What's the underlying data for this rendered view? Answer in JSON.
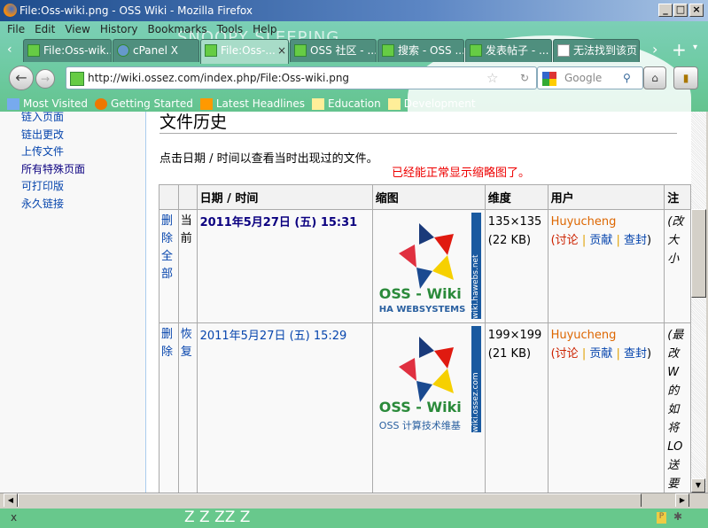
{
  "window": {
    "title": "File:Oss-wiki.png - OSS Wiki - Mozilla Firefox"
  },
  "menu": [
    "File",
    "Edit",
    "View",
    "History",
    "Bookmarks",
    "Tools",
    "Help"
  ],
  "tabs": [
    "File:Oss-wik...",
    "cPanel X",
    "File:Oss-...",
    "OSS 社区 - ...",
    "搜索 - OSS ...",
    "发表帖子 - ...",
    "无法找到该页"
  ],
  "url": "http://wiki.ossez.com/index.php/File:Oss-wiki.png",
  "search_placeholder": "Google",
  "bookmarks": [
    "Most Visited",
    "Getting Started",
    "Latest Headlines",
    "Education",
    "Development"
  ],
  "sidebar": [
    "链入页面",
    "链出更改",
    "上传文件",
    "所有特殊页面",
    "可打印版",
    "永久链接"
  ],
  "page": {
    "heading": "文件历史",
    "intro": "点击日期 / 时间以查看当时出现过的文件。",
    "note": "已经能正常显示缩略图了。"
  },
  "table": {
    "headers": [
      "",
      "",
      "日期 / 时间",
      "缩图",
      "维度",
      "用户",
      "注"
    ],
    "rows": [
      {
        "action": "删除全部",
        "state": "当前",
        "datetime": "2011年5月27日 (五) 15:31",
        "thumb_title": "OSS - Wiki",
        "thumb_sub": "HA WEBSYSTEMS",
        "thumb_side": "wiki.hawebs.net",
        "dims": "135×135",
        "size": "(22 KB)",
        "user": "Huyucheng",
        "talk": "讨论",
        "contribs": "贡献",
        "block": "查封",
        "comment": "(改 大 小"
      },
      {
        "action": "删除",
        "state": "恢复",
        "datetime": "2011年5月27日 (五) 15:29",
        "thumb_title": "OSS - Wiki",
        "thumb_sub": "OSS 计算技术维基",
        "thumb_side": "wiki.ossez.com",
        "dims": "199×199",
        "size": "(21 KB)",
        "user": "Huyucheng",
        "talk": "讨论",
        "contribs": "贡献",
        "block": "查封",
        "comment": "(最 改 W 的 如 将 LO 送 要"
      }
    ]
  },
  "statusbar": {
    "close": "x",
    "art_text": "Z Z ZZ Z"
  },
  "chrome_art_text": "SNOOPY SLEEPING"
}
